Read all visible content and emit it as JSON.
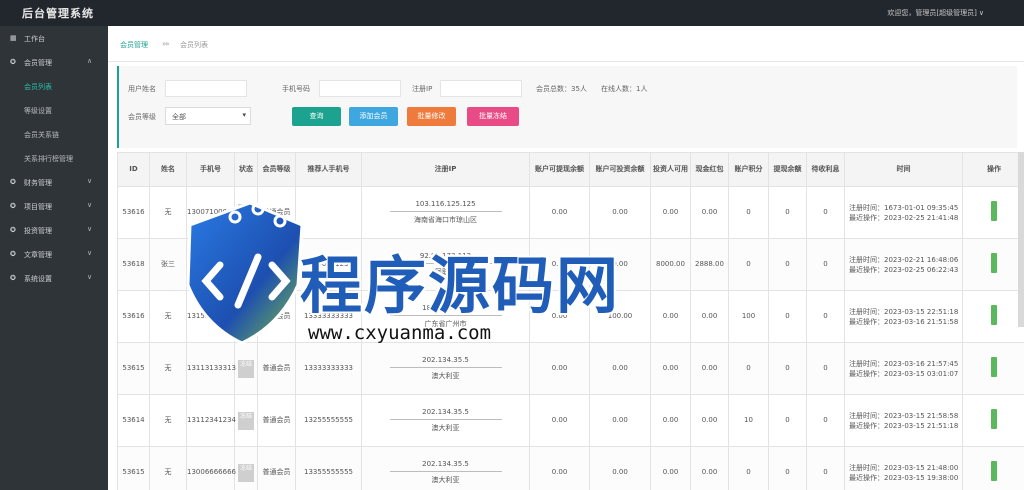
{
  "app": {
    "title": "后台管理系统",
    "user": "欢迎您，管理员[超级管理员]"
  },
  "sidebar": {
    "items": [
      {
        "label": "工作台",
        "icon": "dashboard-icon"
      },
      {
        "label": "会员管理",
        "icon": "gear-icon",
        "expanded": true
      },
      {
        "label": "会员列表",
        "active": true
      },
      {
        "label": "等级设置"
      },
      {
        "label": "会员关系链"
      },
      {
        "label": "关系排行榜管理"
      },
      {
        "label": "财务管理",
        "icon": "gear-icon"
      },
      {
        "label": "项目管理",
        "icon": "gear-icon"
      },
      {
        "label": "投资管理",
        "icon": "gear-icon"
      },
      {
        "label": "文章管理",
        "icon": "gear-icon"
      },
      {
        "label": "系统设置",
        "icon": "gear-icon"
      }
    ]
  },
  "breadcrumb": {
    "parent": "会员管理",
    "separator": "»»",
    "current": "会员列表"
  },
  "filter": {
    "username_label": "用户姓名",
    "phone_label": "手机号码",
    "ip_label": "注册IP",
    "level_label": "会员等级",
    "level_value": "全部",
    "total_label": "会员总数：",
    "total_value": "35人",
    "online_label": "在线人数：",
    "online_value": "1人",
    "buttons": [
      {
        "label": "查询",
        "color": "#1ba38f"
      },
      {
        "label": "添加会员",
        "color": "#3fa7e0"
      },
      {
        "label": "批量修改",
        "color": "#ee7a3c"
      },
      {
        "label": "批量冻结",
        "color": "#e94b86"
      }
    ]
  },
  "table": {
    "columns": [
      "ID",
      "姓名",
      "手机号",
      "状态",
      "会员等级",
      "推荐人手机号",
      "注册IP",
      "账户可提现余额",
      "账户可投资余额",
      "投资人可用",
      "现金红包",
      "账户积分",
      "提现余额",
      "待收利息",
      "时间",
      "操作"
    ],
    "rows": [
      {
        "id": "53616",
        "name": "无",
        "phone": "13007100000",
        "status": "正常",
        "level": "普通会员",
        "referrer": "",
        "ip": "103.116.125.125",
        "ip_loc": "海南省海口市琼山区",
        "c1": "0.00",
        "c2": "0.00",
        "c3": "0.00",
        "c4": "0.00",
        "c5": "0",
        "c6": "0",
        "c7": "0",
        "reg": "注册时间：1673-01-01 09:35:45",
        "login": "最近操作：2023-02-25 21:41:48"
      },
      {
        "id": "53618",
        "name": "张三",
        "phone": "13000000000",
        "status": "正常",
        "level": "普通会员",
        "referrer": "13000001234",
        "ip": "92.98.173.112",
        "ip_loc": "阿联酋",
        "c1": "0.00",
        "c2": "0.00",
        "c3": "8000.00",
        "c4": "2888.00",
        "c5": "0",
        "c6": "0",
        "c7": "0",
        "reg": "注册时间：2023-02-21 16:48:06",
        "login": "最近操作：2023-02-25 06:22:43"
      },
      {
        "id": "53616",
        "name": "无",
        "phone": "13155555555",
        "status": "冻结",
        "level": "普通会员",
        "referrer": "13333333333",
        "ip": "183.4.65.206",
        "ip_loc": "广东省广州市",
        "c1": "0.00",
        "c2": "100.00",
        "c3": "0.00",
        "c4": "0.00",
        "c5": "100",
        "c6": "0",
        "c7": "0",
        "reg": "注册时间：2023-03-15 22:51:18",
        "login": "最近操作：2023-03-16 21:51:58"
      },
      {
        "id": "53615",
        "name": "无",
        "phone": "13113133313",
        "status": "冻结",
        "level": "普通会员",
        "referrer": "13333333333",
        "ip": "202.134.35.5",
        "ip_loc": "澳大利亚",
        "c1": "0.00",
        "c2": "0.00",
        "c3": "0.00",
        "c4": "0.00",
        "c5": "0",
        "c6": "0",
        "c7": "0",
        "reg": "注册时间：2023-03-16 21:57:45",
        "login": "最近操作：2023-03-15 03:01:07"
      },
      {
        "id": "53614",
        "name": "无",
        "phone": "13112341234",
        "status": "冻结",
        "level": "普通会员",
        "referrer": "13255555555",
        "ip": "202.134.35.5",
        "ip_loc": "澳大利亚",
        "c1": "0.00",
        "c2": "0.00",
        "c3": "0.00",
        "c4": "0.00",
        "c5": "10",
        "c6": "0",
        "c7": "0",
        "reg": "注册时间：2023-03-15 21:58:58",
        "login": "最近操作：2023-03-15 21:51:18"
      },
      {
        "id": "53615",
        "name": "无",
        "phone": "13006666666",
        "status": "冻结",
        "level": "普通会员",
        "referrer": "13355555555",
        "ip": "202.134.35.5",
        "ip_loc": "澳大利亚",
        "c1": "0.00",
        "c2": "0.00",
        "c3": "0.00",
        "c4": "0.00",
        "c5": "0",
        "c6": "0",
        "c7": "0",
        "reg": "注册时间：2023-03-15 21:48:00",
        "login": "最近操作：2023-03-15 19:38:00"
      }
    ]
  },
  "watermark": {
    "text": "程序源码网",
    "url": "www.cxyuanma.com",
    "color": "#1f5db8"
  }
}
